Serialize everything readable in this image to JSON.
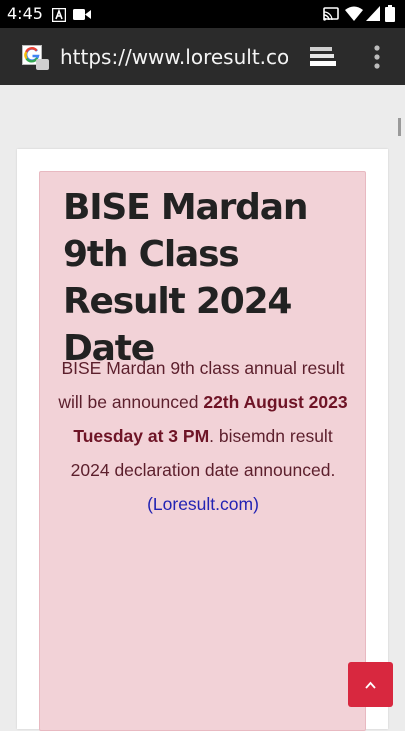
{
  "status_bar": {
    "time": "4:45",
    "notification_icons": [
      "a-app-icon",
      "video-camera-icon"
    ],
    "system_icons": [
      "cast-icon",
      "wifi-icon",
      "signal-icon",
      "battery-icon"
    ]
  },
  "browser": {
    "url": "https://www.loresult.com",
    "favicon": "google-g-icon",
    "actions": [
      "tab-switcher-icon",
      "overflow-menu-icon"
    ]
  },
  "article": {
    "title": "BISE Mardan 9th Class Result 2024 Date",
    "body_part1": "BISE Mardan 9th class annual result will be announced ",
    "body_bold": "22th August 2023 Tuesday at 3 PM",
    "body_part2": ". bisemdn result 2024 declaration date announced. ",
    "link_text": "(Loresult.com)"
  },
  "back_to_top": {
    "icon": "chevron-up-icon"
  },
  "colors": {
    "status_bar": "#000000",
    "toolbar": "#2b2b2b",
    "page_bg": "#ececec",
    "panel_bg": "#f2d2d7",
    "body_text": "#5c1f2c",
    "link": "#2323b3",
    "back_to_top_button": "#d8283f"
  }
}
